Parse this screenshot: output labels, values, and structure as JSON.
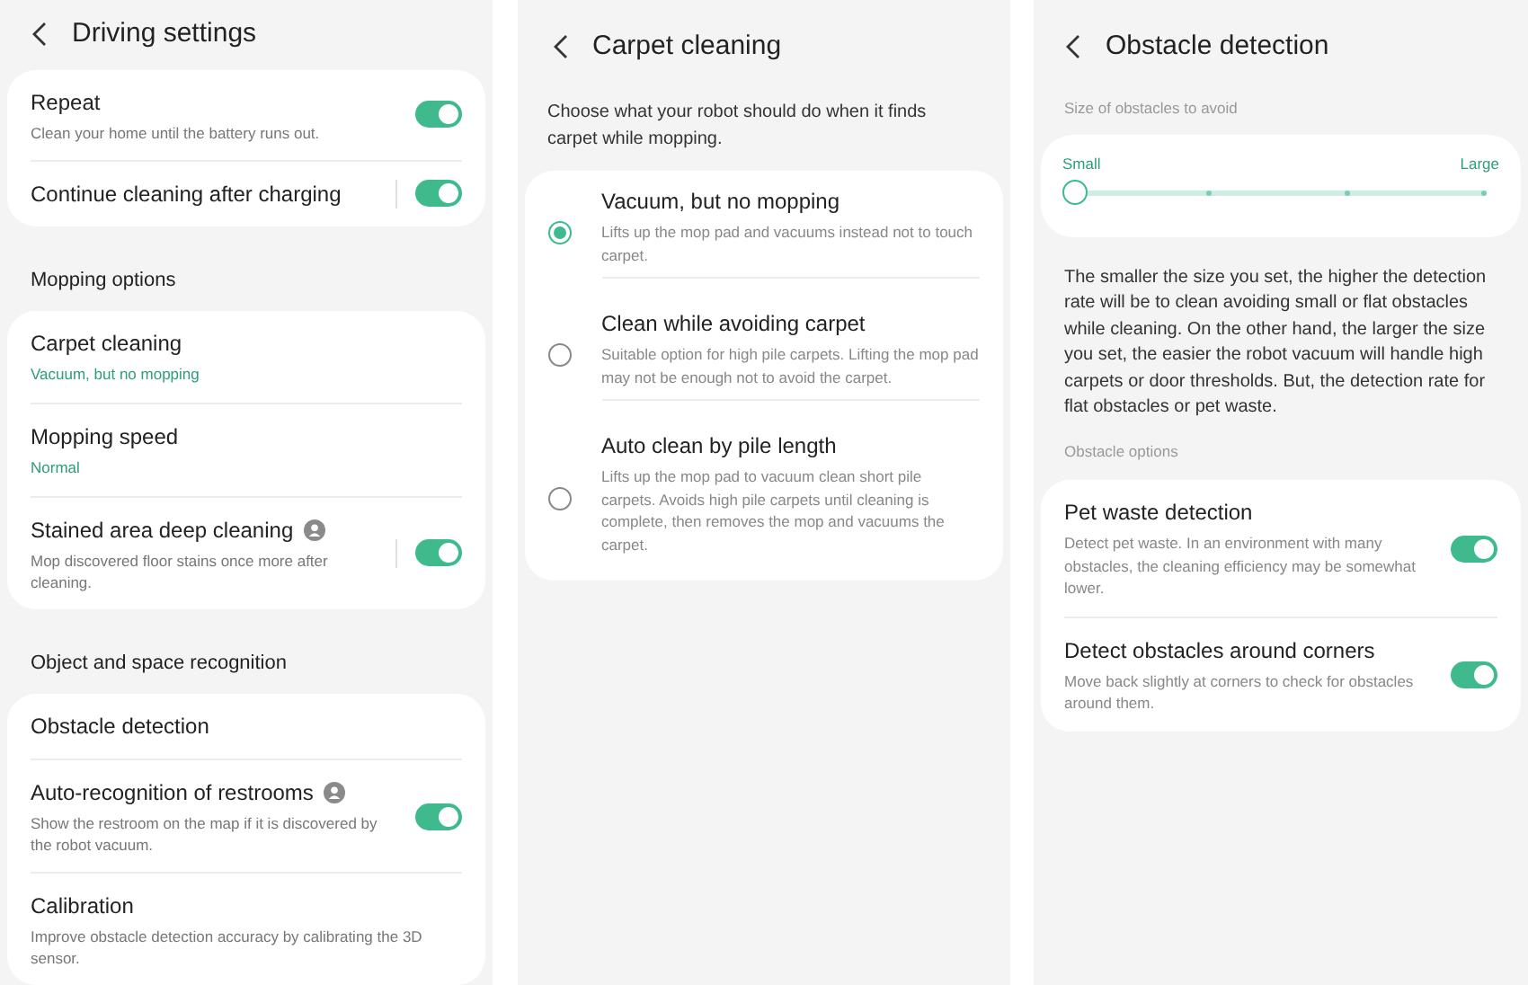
{
  "driving_settings": {
    "title": "Driving settings",
    "sections": [
      {
        "items": [
          {
            "kind": "toggle",
            "title": "Repeat",
            "description": "Clean your home until the battery runs out.",
            "on": true,
            "divider": false,
            "badge": false
          },
          {
            "kind": "toggle",
            "title": "Continue cleaning after charging",
            "on": true,
            "divider": true,
            "badge": false
          }
        ]
      },
      {
        "header": "Mopping options",
        "items": [
          {
            "kind": "value",
            "title": "Carpet cleaning",
            "value": "Vacuum, but no mopping"
          },
          {
            "kind": "value",
            "title": "Mopping speed",
            "value": "Normal"
          },
          {
            "kind": "toggle",
            "title": "Stained area deep cleaning",
            "description": "Mop discovered floor stains once more after cleaning.",
            "on": true,
            "divider": true,
            "badge": true
          }
        ]
      },
      {
        "header": "Object and space recognition",
        "items": [
          {
            "kind": "link",
            "title": "Obstacle detection"
          },
          {
            "kind": "toggle",
            "title": "Auto-recognition of restrooms",
            "description": "Show the restroom on the map if it is discovered by the robot vacuum.",
            "on": true,
            "divider": false,
            "badge": true
          },
          {
            "kind": "link",
            "title": "Calibration",
            "description": "Improve obstacle detection accuracy by calibrating the 3D sensor."
          }
        ]
      }
    ]
  },
  "carpet_cleaning": {
    "title": "Carpet cleaning",
    "intro": "Choose what your robot should do when it finds carpet while mopping.",
    "options": [
      {
        "title": "Vacuum, but no mopping",
        "description": "Lifts up the mop pad and vacuums instead not to touch carpet.",
        "selected": true
      },
      {
        "title": "Clean while avoiding carpet",
        "description": "Suitable option for high pile carpets. Lifting the mop pad may not be enough not to avoid the carpet.",
        "selected": false
      },
      {
        "title": "Auto clean by pile length",
        "description": "Lifts up the mop pad to vacuum clean short pile carpets. Avoids high pile carpets until cleaning is complete, then removes the mop and vacuums the carpet.",
        "selected": false
      }
    ]
  },
  "obstacle_detection": {
    "title": "Obstacle detection",
    "size_label": "Size of obstacles to avoid",
    "slider": {
      "min_label": "Small",
      "max_label": "Large",
      "level": 0
    },
    "explanation": "The smaller the size you set, the higher the detection rate will be to clean avoiding small or flat obstacles while cleaning. On the other hand, the larger the size you set, the easier the robot vacuum will handle high carpets or door thresholds. But, the detection rate for flat obstacles or pet waste.",
    "options_label": "Obstacle options",
    "options": [
      {
        "title": "Pet waste detection",
        "description": "Detect pet waste. In an environment with many obstacles, the cleaning efficiency may be somewhat lower.",
        "on": true
      },
      {
        "title": "Detect obstacles around corners",
        "description": "Move back slightly at corners to check for obstacles around them.",
        "on": true
      }
    ]
  }
}
